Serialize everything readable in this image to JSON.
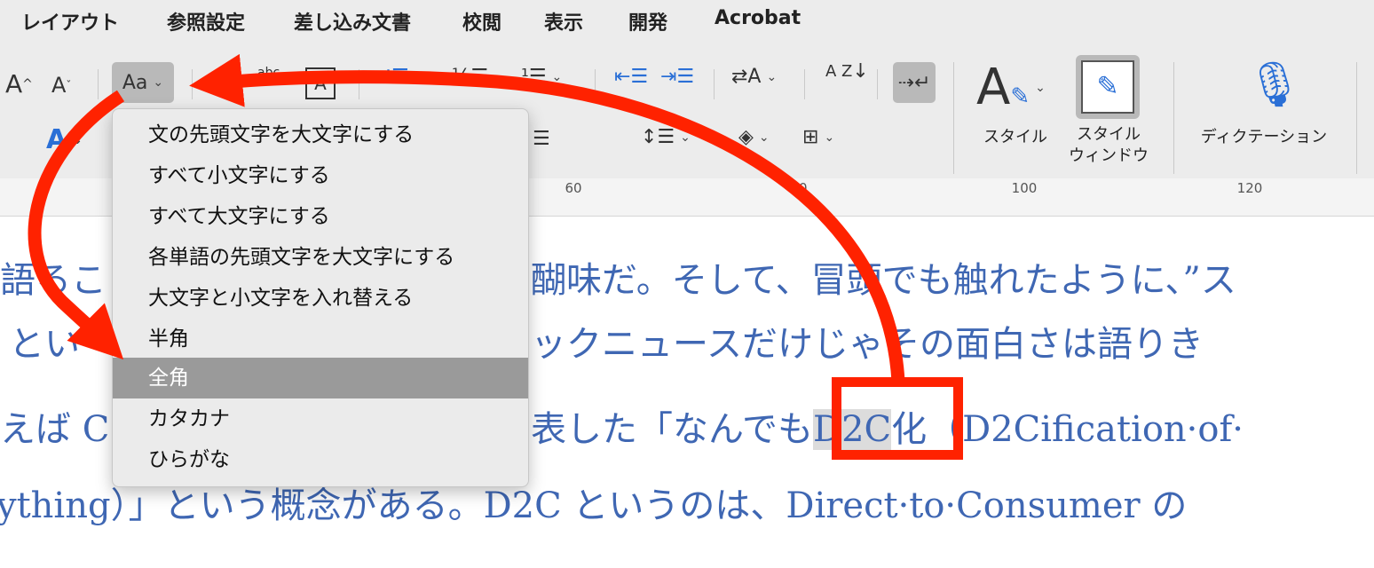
{
  "menubar": {
    "items": [
      "レイアウト",
      "参照設定",
      "差し込み文書",
      "校閲",
      "表示",
      "開発",
      "Acrobat"
    ]
  },
  "ribbon": {
    "grow_font": "A",
    "shrink_font": "A",
    "change_case": "Aa",
    "phonetic": "abc",
    "border_char": "A",
    "text_effect": "A",
    "styles_label": "スタイル",
    "styles_pane_label": "スタイル\nウィンドウ",
    "dictation_label": "ディクテーション",
    "sort": "A Z"
  },
  "ruler": {
    "marks": [
      "60",
      "80",
      "100",
      "120"
    ]
  },
  "dropdown": {
    "items": [
      "文の先頭文字を大文字にする",
      "すべて小文字にする",
      "すべて大文字にする",
      "各単語の先頭文字を大文字にする",
      "大文字と小文字を入れ替える",
      "半角",
      "全角",
      "カタカナ",
      "ひらがな"
    ],
    "selected": "全角"
  },
  "document": {
    "line2_a": "語るこ",
    "line2_b": "醐味だ。そして、冒頭でも触れたように、”ス",
    "line3_a": "とい",
    "line3_b": "ックニュースだけじゃその面白さは語りき",
    "line4_a": "えば C",
    "line4_b": "表した「なんでも",
    "line4_sel": "D2C",
    "line4_c": "化（D2Cification·of·",
    "line5": "ything）」という概念がある。D2C というのは、Direct·to·Consumer の"
  },
  "colors": {
    "annotation": "#ff2200",
    "document_text": "#3f67b3",
    "selected_item": "#9a9a9a"
  }
}
